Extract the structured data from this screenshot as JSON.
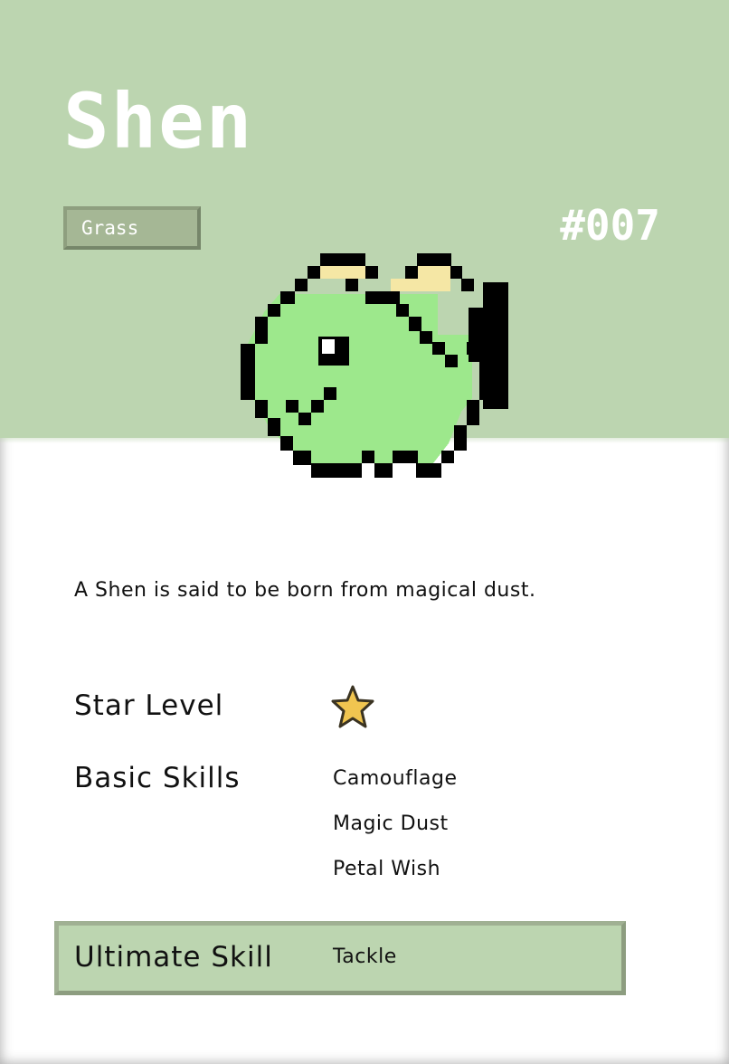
{
  "creature": {
    "name": "Shen",
    "type": "Grass",
    "number": "#007",
    "description": "A Shen is said to be born from magical dust."
  },
  "stats": {
    "star_level_label": "Star Level",
    "star_level": 1,
    "basic_skills_label": "Basic Skills",
    "basic_skills": [
      "Camouflage",
      "Magic Dust",
      "Petal Wish"
    ],
    "ultimate_skill_label": "Ultimate Skill",
    "ultimate_skill": "Tackle"
  },
  "icons": {
    "sprite": "green-dragon-sprite",
    "star": "star-icon"
  },
  "colors": {
    "header_bg": "#bcd5b0",
    "badge_bg": "#a5b795",
    "sprite_body": "#9de88c",
    "sprite_horn": "#f5e7a5",
    "star_fill": "#f0c550"
  }
}
